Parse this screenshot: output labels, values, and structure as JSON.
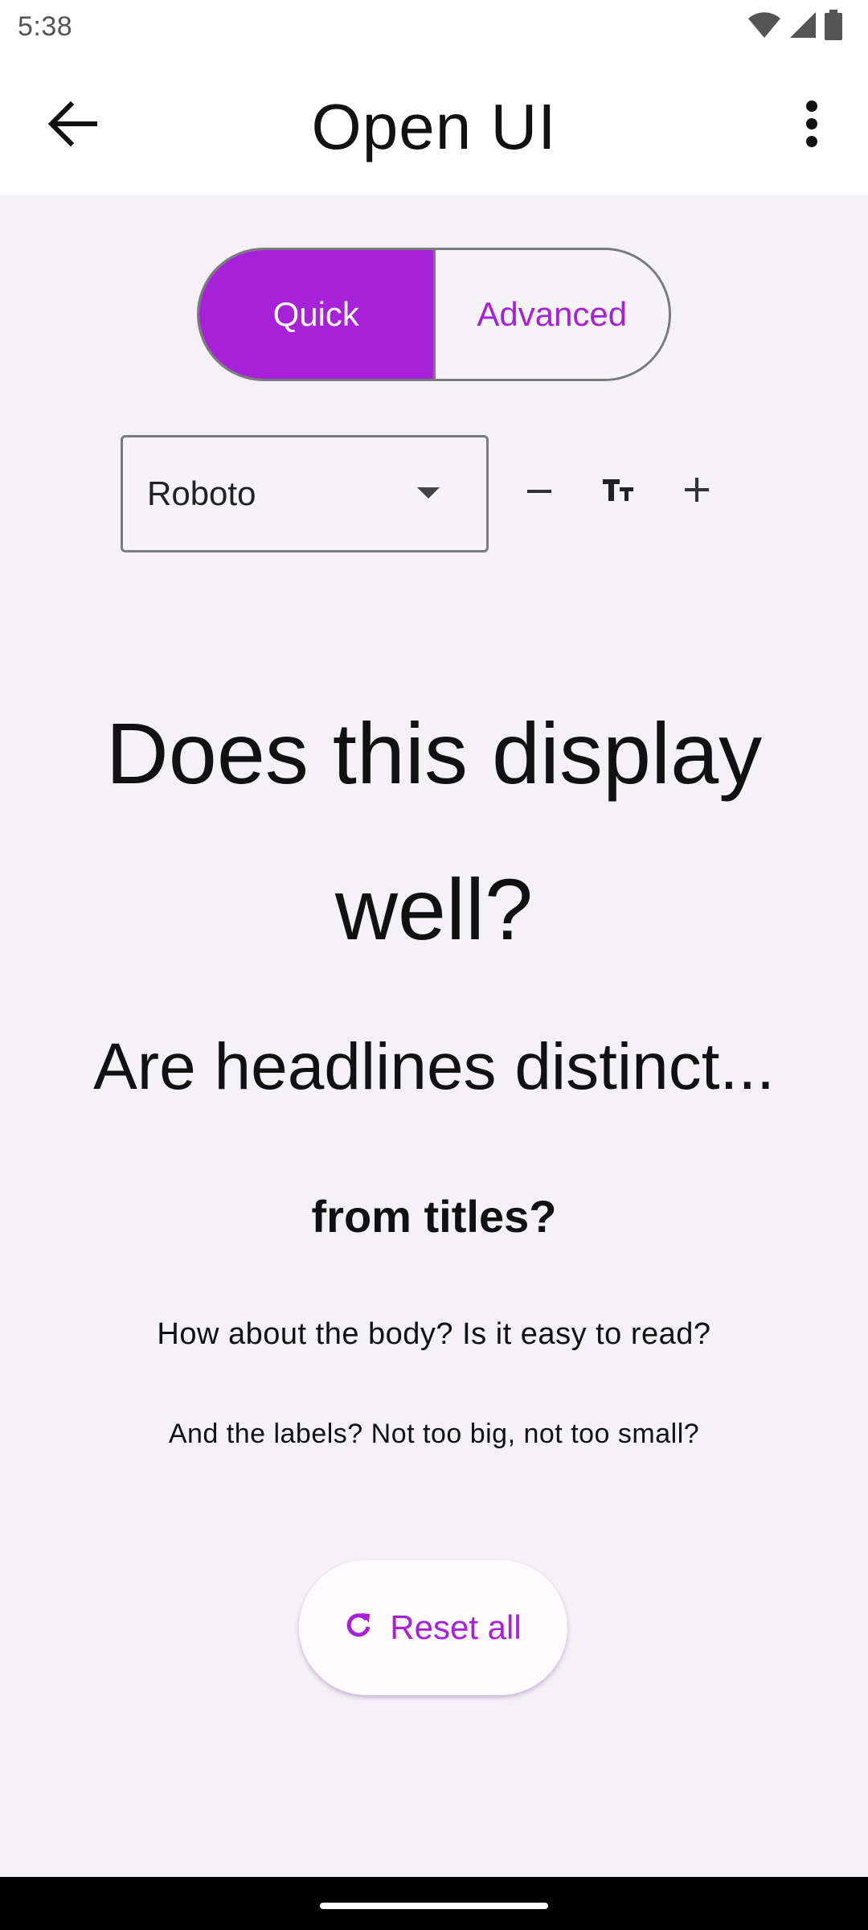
{
  "status_bar": {
    "time": "5:38",
    "icons": [
      "wifi-icon",
      "signal-icon",
      "battery-icon"
    ]
  },
  "app_bar": {
    "title": "Open UI",
    "back_icon": "arrow-back-icon",
    "menu_icon": "more-vert-icon"
  },
  "mode_toggle": {
    "options": [
      {
        "label": "Quick",
        "selected": true
      },
      {
        "label": "Advanced",
        "selected": false
      }
    ]
  },
  "font_controls": {
    "font_family_value": "Roboto",
    "decrease_icon": "minus-icon",
    "text_size_icon": "text-size-icon",
    "increase_icon": "plus-icon"
  },
  "preview": {
    "display": "Does this display well?",
    "headline": "Are headlines distinct...",
    "title": "from titles?",
    "body": "How about the body? Is it easy to read?",
    "label": "And the labels? Not too big, not too small?"
  },
  "reset": {
    "label": "Reset all",
    "icon": "refresh-icon"
  },
  "colors": {
    "accent": "#a621d8",
    "background": "#f4f2f6",
    "app_bar": "#ffffff"
  }
}
